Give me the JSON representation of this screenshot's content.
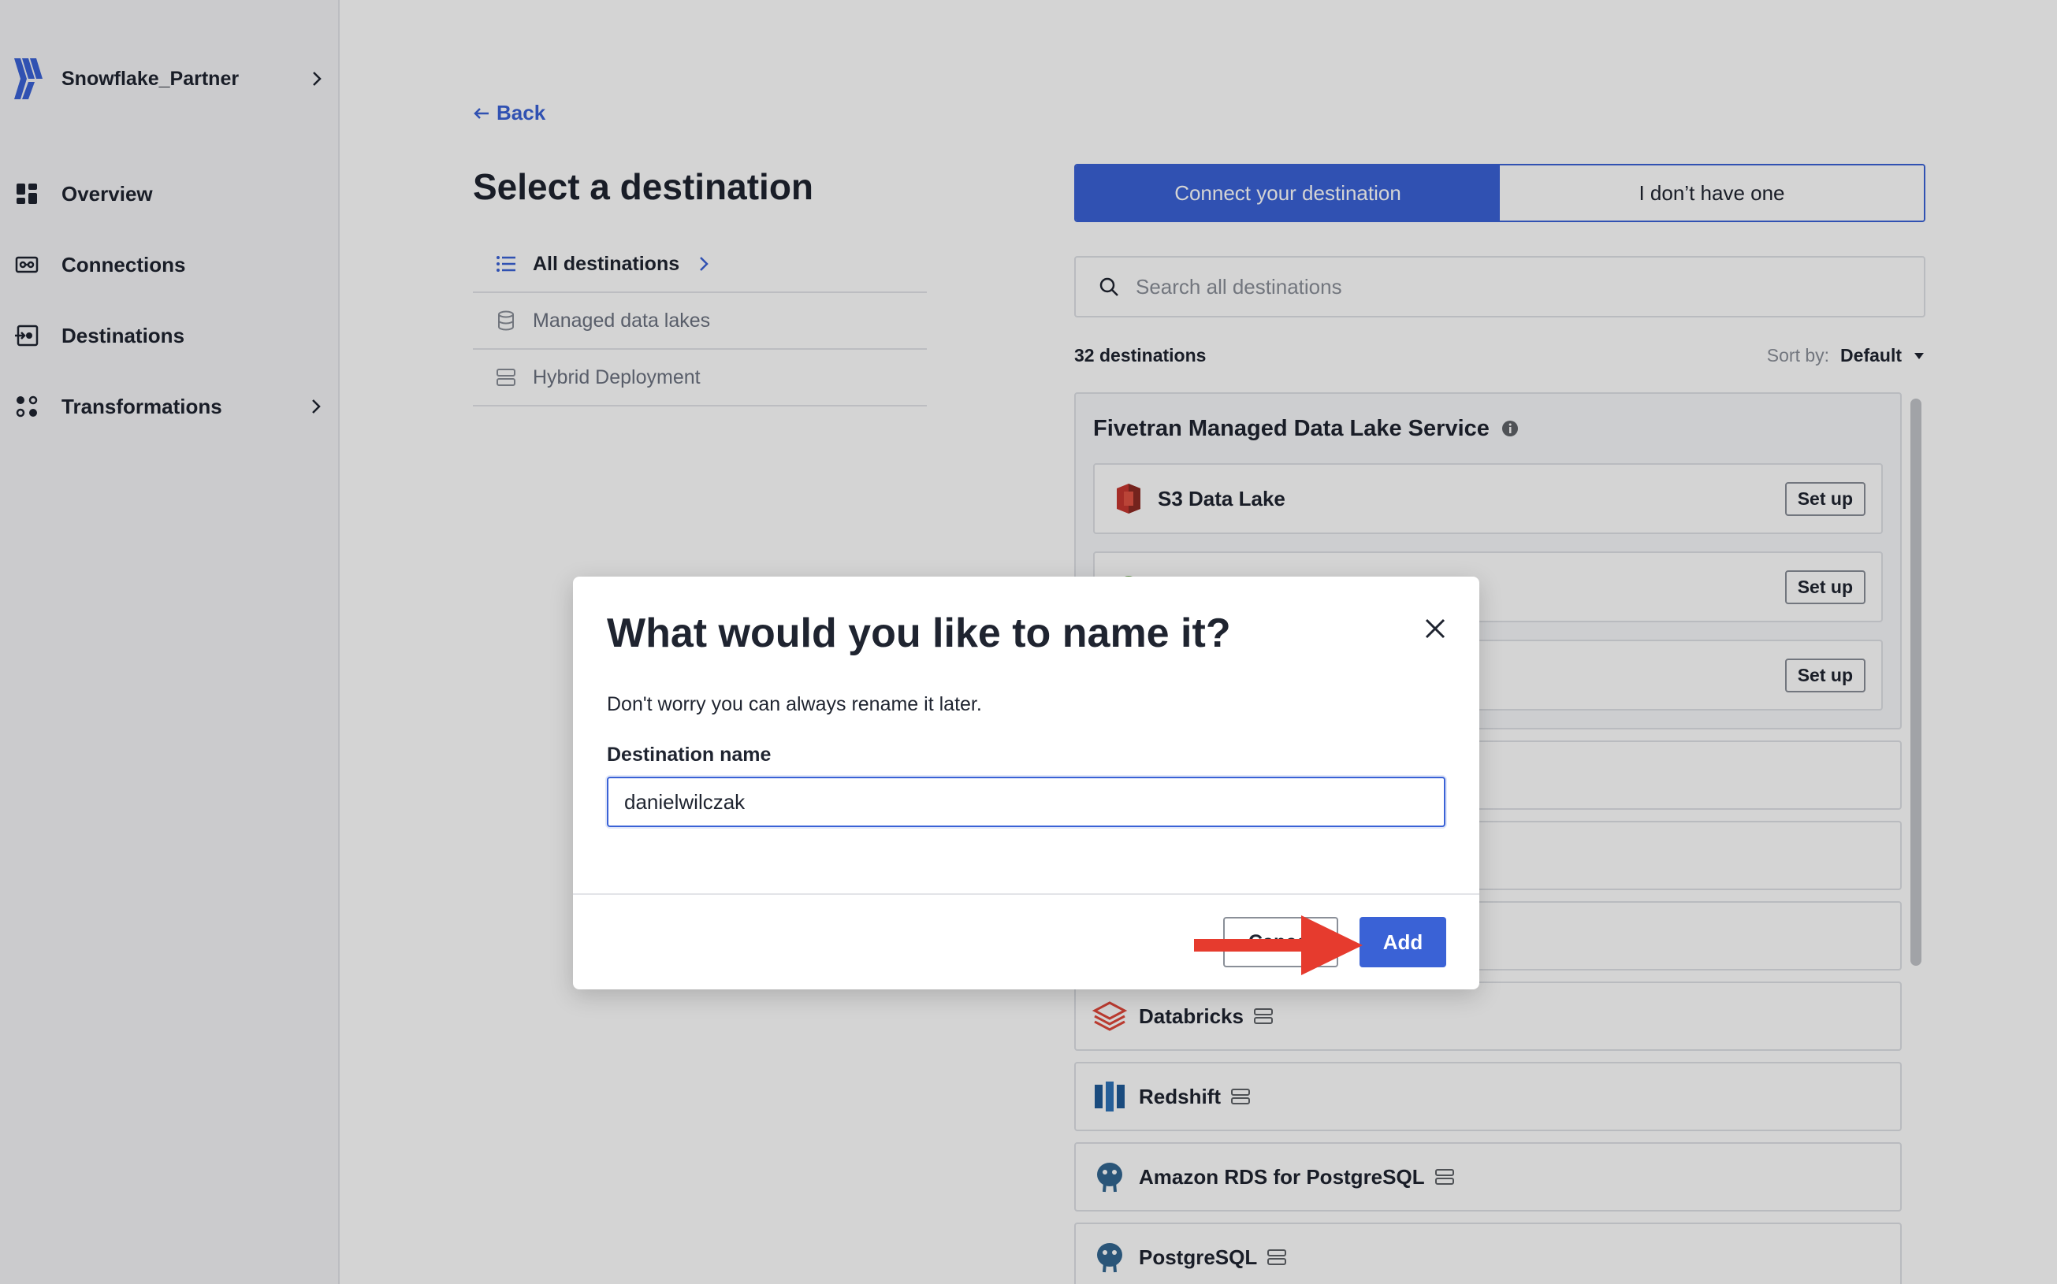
{
  "sidebar": {
    "account_name": "Snowflake_Partner",
    "items": [
      {
        "label": "Overview",
        "icon": "dashboard-icon"
      },
      {
        "label": "Connections",
        "icon": "connections-icon"
      },
      {
        "label": "Destinations",
        "icon": "destinations-icon"
      },
      {
        "label": "Transformations",
        "icon": "transformations-icon"
      }
    ]
  },
  "main": {
    "back_label": "Back",
    "title": "Select a destination",
    "categories": [
      {
        "label": "All destinations",
        "icon": "list-icon"
      },
      {
        "label": "Managed data lakes",
        "icon": "database-icon"
      },
      {
        "label": "Hybrid Deployment",
        "icon": "server-icon"
      }
    ],
    "tabs": [
      "Connect your destination",
      "I don’t have one"
    ],
    "search_placeholder": "Search all destinations",
    "count_label": "32 destinations",
    "sort_label": "Sort by:",
    "sort_value": "Default",
    "group_title": "Fivetran Managed Data Lake Service",
    "group_items": [
      {
        "name": "S3 Data Lake",
        "action": "Set up"
      },
      {
        "name": "",
        "action": "Set up"
      },
      {
        "name": "",
        "action": "Set up"
      }
    ],
    "destinations": [
      {
        "name": "",
        "icon": ""
      },
      {
        "name": "",
        "icon": ""
      },
      {
        "name": "",
        "icon": ""
      },
      {
        "name": "Databricks",
        "icon": "databricks-icon"
      },
      {
        "name": "Redshift",
        "icon": "redshift-icon"
      },
      {
        "name": "Amazon RDS for PostgreSQL",
        "icon": "postgresql-icon"
      },
      {
        "name": "PostgreSQL",
        "icon": "postgresql-icon"
      }
    ]
  },
  "modal": {
    "title": "What would you like to name it?",
    "subtitle": "Don't worry you can always rename it later.",
    "field_label": "Destination name",
    "field_value": "danielwilczak",
    "cancel_label": "Cancel",
    "add_label": "Add"
  },
  "colors": {
    "accent": "#3a62d6",
    "arrow": "#e63b2e"
  }
}
